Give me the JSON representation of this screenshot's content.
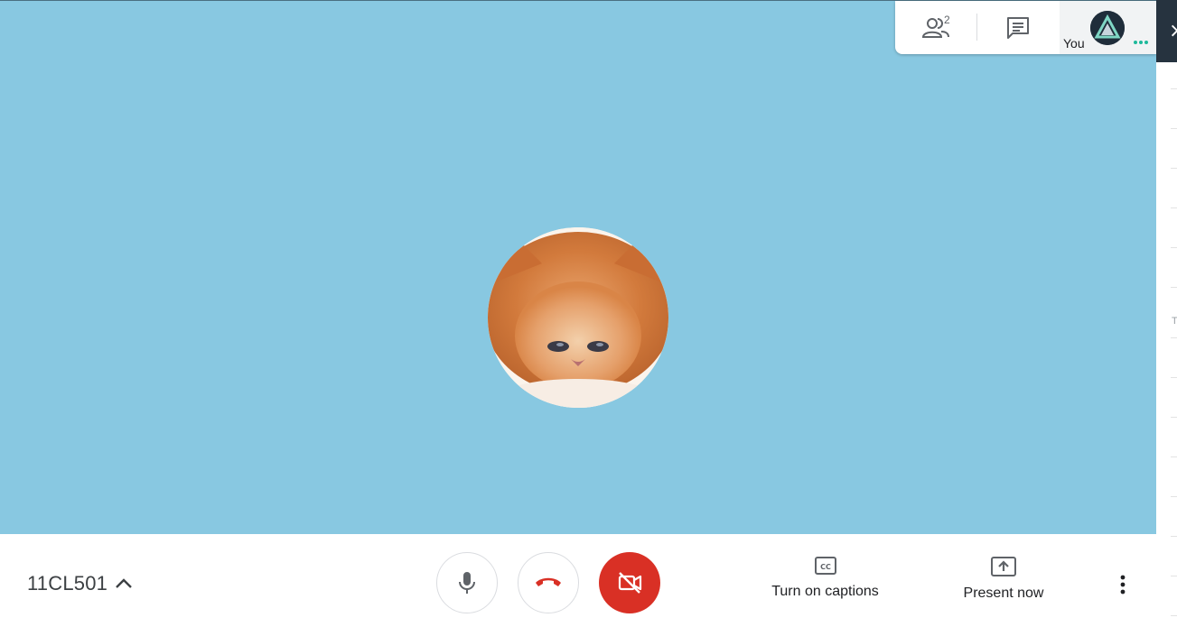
{
  "stage": {
    "background_color": "#88c8e1",
    "participant_avatar": "cat-photo-avatar"
  },
  "topbar": {
    "people_icon": "people-icon",
    "participant_count": "2",
    "chat_icon": "chat-icon",
    "self_label": "You",
    "self_avatar": "self-avatar",
    "options_icon": "more-dots-icon"
  },
  "bottombar": {
    "meeting_code": "11CL501",
    "meeting_details_icon": "chevron-up-icon",
    "mic_icon": "mic-icon",
    "hangup_icon": "hangup-icon",
    "camera_off_icon": "camera-off-icon",
    "captions_label": "Turn on captions",
    "captions_icon": "captions-icon",
    "present_label": "Present now",
    "present_icon": "present-icon",
    "more_icon": "more-vertical-icon"
  },
  "colors": {
    "accent_red": "#d93025",
    "stage_blue": "#88c8e1",
    "online_dots": "#1db99a"
  },
  "side_panel": {
    "close_icon": "close-icon"
  }
}
